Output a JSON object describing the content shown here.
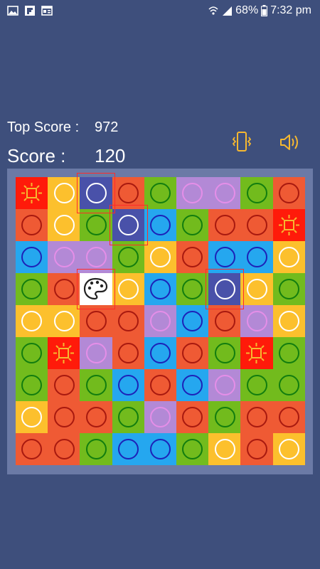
{
  "status": {
    "battery": "68%",
    "time": "7:32 pm"
  },
  "scores": {
    "top_label": "Top Score :",
    "top_value": "972",
    "score_label": "Score :",
    "score_value": "120"
  },
  "icons": {
    "vibrate": "vibrate-phone-icon",
    "sound": "speaker-volume-icon",
    "palette": "palette-icon",
    "sun": "sun-icon"
  },
  "colors": {
    "background": "#3e4f7c",
    "board": "#6b7aa6",
    "red": "#ef5a34",
    "yellow": "#fcc02d",
    "green": "#72bb1d",
    "blue": "#25a7ef",
    "purple": "#b389d6",
    "special_red": "#ff1a0a",
    "navy": "#4951a9",
    "white": "#ffffff",
    "accent_icons": "#f6b830",
    "selection": "#ff2a2a"
  },
  "board": {
    "rows": 9,
    "cols": 9,
    "grid": [
      [
        "sun",
        "yellow",
        "navy",
        "red",
        "green",
        "purple",
        "purple",
        "green",
        "red"
      ],
      [
        "red",
        "yellow",
        "green",
        "navy",
        "blue",
        "green",
        "red",
        "red",
        "sun"
      ],
      [
        "blue",
        "purple",
        "purple",
        "green",
        "yellow",
        "red",
        "blue",
        "blue",
        "yellow"
      ],
      [
        "green",
        "red",
        "palette",
        "yellow",
        "blue",
        "green",
        "navy",
        "yellow",
        "green"
      ],
      [
        "yellow",
        "yellow",
        "red",
        "red",
        "purple",
        "blue",
        "red",
        "purple",
        "yellow"
      ],
      [
        "green",
        "sun",
        "purple",
        "red",
        "blue",
        "red",
        "green",
        "sun",
        "green"
      ],
      [
        "green",
        "red",
        "green",
        "blue",
        "red",
        "blue",
        "purple",
        "green",
        "green"
      ],
      [
        "yellow",
        "red",
        "red",
        "green",
        "purple",
        "red",
        "green",
        "red",
        "red"
      ],
      [
        "red",
        "red",
        "green",
        "blue",
        "blue",
        "green",
        "yellow",
        "red",
        "yellow"
      ]
    ],
    "selected": [
      [
        0,
        2
      ],
      [
        1,
        3
      ],
      [
        3,
        2
      ],
      [
        3,
        6
      ]
    ]
  }
}
